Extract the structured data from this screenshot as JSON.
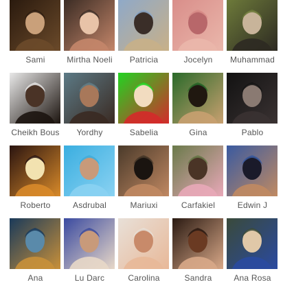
{
  "friends": [
    {
      "name": "Sami",
      "avatar": "photo-sami",
      "colors": [
        "#2a1a0e",
        "#6b4a2a",
        "#c9a07a"
      ]
    },
    {
      "name": "Mirtha Noeli",
      "avatar": "photo-mirtha-noeli",
      "colors": [
        "#3b2c24",
        "#c4866a",
        "#e8c3a8"
      ]
    },
    {
      "name": "Patricia",
      "avatar": "photo-patricia",
      "colors": [
        "#8fa9c8",
        "#c8b088",
        "#3a2e28"
      ]
    },
    {
      "name": "Jocelyn",
      "avatar": "photo-jocelyn",
      "colors": [
        "#d98e8a",
        "#eab7ab",
        "#b8676a"
      ]
    },
    {
      "name": "Muhammad",
      "avatar": "photo-muhammad",
      "colors": [
        "#6d7a3a",
        "#2d2a22",
        "#c8b49a"
      ]
    },
    {
      "name": "Cheikh Bous",
      "avatar": "photo-cheikh-bous",
      "colors": [
        "#e8e8e8",
        "#1c140f",
        "#4a3326"
      ]
    },
    {
      "name": "Yordhy",
      "avatar": "photo-yordhy",
      "colors": [
        "#5c7a86",
        "#3a2a22",
        "#a8785a"
      ]
    },
    {
      "name": "Sabelia",
      "avatar": "cartoon-sabelia",
      "colors": [
        "#22d322",
        "#d42a2a",
        "#f2dcc0"
      ]
    },
    {
      "name": "Gina",
      "avatar": "photo-gina",
      "colors": [
        "#2a6a2a",
        "#c8a070",
        "#201810"
      ]
    },
    {
      "name": "Pablo",
      "avatar": "photo-pablo",
      "colors": [
        "#121212",
        "#3a3232",
        "#8a7a72"
      ]
    },
    {
      "name": "Roberto",
      "avatar": "flyer-roberto",
      "colors": [
        "#2a1410",
        "#d88a2a",
        "#f2e2b0"
      ]
    },
    {
      "name": "Asdrubal",
      "avatar": "photo-asdrubal",
      "colors": [
        "#3aaee0",
        "#8ad2f2",
        "#c89a7a"
      ]
    },
    {
      "name": "Mariuxi",
      "avatar": "photo-mariuxi",
      "colors": [
        "#4a3a2a",
        "#c08862",
        "#1a1410"
      ]
    },
    {
      "name": "Carfakiel",
      "avatar": "photo-carfakiel",
      "colors": [
        "#6a7a4a",
        "#e8a8b8",
        "#4a3426"
      ]
    },
    {
      "name": "Edwin J",
      "avatar": "photo-edwin-j",
      "colors": [
        "#3a5aa0",
        "#c08a62",
        "#1a1a2a"
      ]
    },
    {
      "name": "Ana",
      "avatar": "artwork-ana",
      "colors": [
        "#1a3a5a",
        "#c8903a",
        "#5a8aaa"
      ]
    },
    {
      "name": "Lu Darc",
      "avatar": "photo-lu-darc",
      "colors": [
        "#3a4aa0",
        "#e8d8c8",
        "#c89a7a"
      ]
    },
    {
      "name": "Carolina",
      "avatar": "photo-carolina",
      "colors": [
        "#e8e0d8",
        "#e8b898",
        "#c88a6a"
      ]
    },
    {
      "name": "Sandra",
      "avatar": "photo-sandra",
      "colors": [
        "#2a1a12",
        "#d8a888",
        "#6a3a22"
      ]
    },
    {
      "name": "Ana Rosa",
      "avatar": "photo-ana-rosa",
      "colors": [
        "#3a4a3a",
        "#2a4aa0",
        "#e0c8a8"
      ]
    }
  ]
}
